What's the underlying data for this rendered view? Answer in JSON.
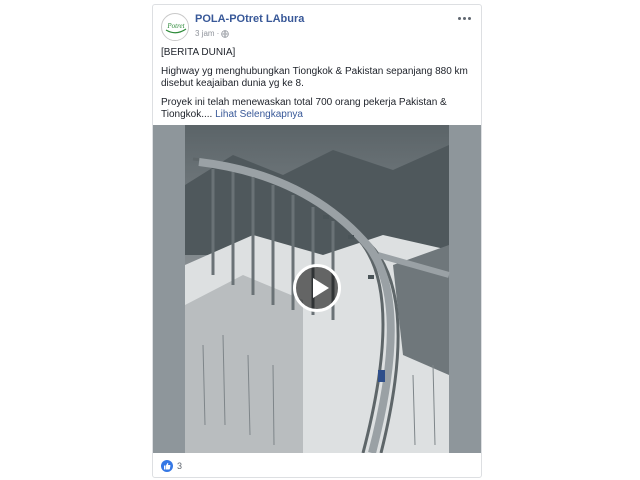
{
  "post": {
    "page_name": "POLA-POtret LAbura",
    "time": "3 jam",
    "avatar_logo_text": "Potret",
    "text_lines": {
      "line1": "[BERITA DUNIA]",
      "line2": "Highway yg menghubungkan Tiongkok & Pakistan sepanjang 880 km disebut keajaiban dunia yg ke 8.",
      "line3_prefix": "Proyek ini telah menewaskan total 700 orang pekerja Pakistan & Tiongkok....",
      "see_more": "Lihat Selengkapnya"
    },
    "reaction_count": "3"
  },
  "icons": {
    "globe": "globe-icon",
    "more": "more-options-icon",
    "play": "play-icon",
    "like": "like-icon"
  },
  "colors": {
    "link": "#385898",
    "like": "#3578e5",
    "text": "#1d2129",
    "meta": "#90949c"
  }
}
